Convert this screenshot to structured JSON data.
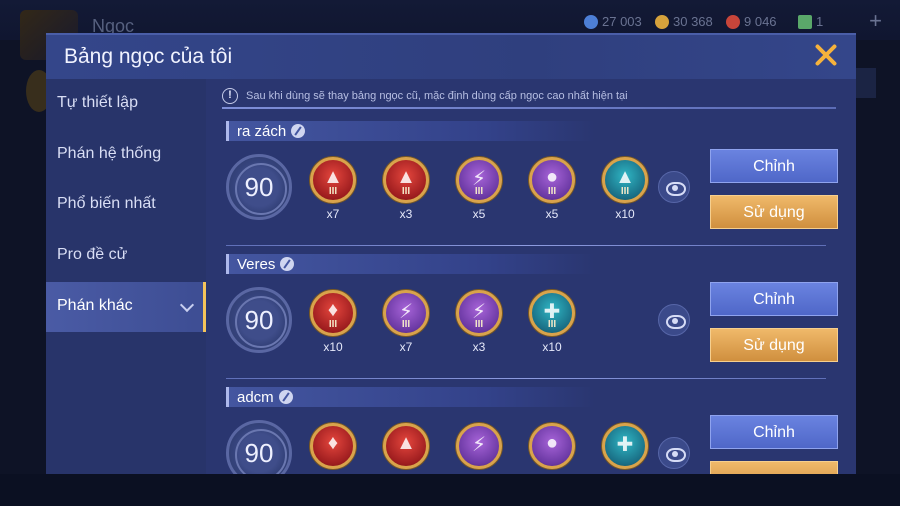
{
  "background": {
    "title": "Ngọc",
    "currencies": [
      {
        "icon": "blue-gem-icon",
        "value": "27 003",
        "color": "#4d7fd6"
      },
      {
        "icon": "gold-coin-icon",
        "value": "30 368",
        "color": "#d6a23c"
      },
      {
        "icon": "red-gem-icon",
        "value": "9 046",
        "color": "#c8453a"
      },
      {
        "icon": "card-icon",
        "value": "1",
        "color": "#5aa86a"
      }
    ]
  },
  "modal": {
    "title": "Bảng ngọc của tôi",
    "notice": "Sau khi dùng sẽ thay bảng ngọc cũ, mặc định dùng cấp ngọc cao nhất hiện tại"
  },
  "sidebar": {
    "items": [
      {
        "label": "Tự thiết lập"
      },
      {
        "label": "Phán hệ thống"
      },
      {
        "label": "Phổ biến nhất"
      },
      {
        "label": "Pro đề cử"
      },
      {
        "label": "Phán khác"
      }
    ]
  },
  "boards": [
    {
      "name": "ra zách",
      "level": "90",
      "runes": [
        {
          "color": "red",
          "icon": "red-flask-icon",
          "tier": "III",
          "count": "x7"
        },
        {
          "color": "red",
          "icon": "red-flask-icon",
          "tier": "III",
          "count": "x3"
        },
        {
          "color": "purple",
          "icon": "purple-lightning-icon",
          "tier": "III",
          "count": "x5"
        },
        {
          "color": "purple",
          "icon": "purple-drop-icon",
          "tier": "III",
          "count": "x5"
        },
        {
          "color": "teal",
          "icon": "teal-flask-icon",
          "tier": "III",
          "count": "x10"
        }
      ],
      "edit_label": "Chỉnh",
      "use_label": "Sử dụng"
    },
    {
      "name": "Veres",
      "level": "90",
      "runes": [
        {
          "color": "red",
          "icon": "red-feather-icon",
          "tier": "III",
          "count": "x10"
        },
        {
          "color": "purple",
          "icon": "purple-lightning-icon",
          "tier": "III",
          "count": "x7"
        },
        {
          "color": "purple",
          "icon": "purple-lightning-icon",
          "tier": "III",
          "count": "x3"
        },
        {
          "color": "teal",
          "icon": "teal-cross-icon",
          "tier": "III",
          "count": "x10"
        }
      ],
      "edit_label": "Chỉnh",
      "use_label": "Sử dụng"
    },
    {
      "name": "adcm",
      "level": "90",
      "runes": [
        {
          "color": "red",
          "icon": "red-feather-icon",
          "tier": "",
          "count": ""
        },
        {
          "color": "red",
          "icon": "red-spike-icon",
          "tier": "",
          "count": ""
        },
        {
          "color": "purple",
          "icon": "purple-lightning-icon",
          "tier": "",
          "count": ""
        },
        {
          "color": "purple",
          "icon": "purple-drop-icon",
          "tier": "",
          "count": ""
        },
        {
          "color": "teal",
          "icon": "teal-cross-icon",
          "tier": "",
          "count": ""
        }
      ],
      "edit_label": "Chỉnh",
      "use_label": ""
    }
  ]
}
